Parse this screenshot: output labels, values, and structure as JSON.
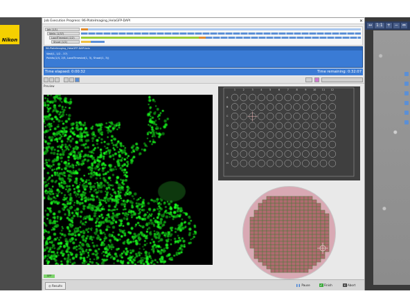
{
  "window": {
    "title": "Job Execution Progress: 96-PlateImaging_HelaGFP-DAPI",
    "close_label": "✕"
  },
  "logo": {
    "text": "Nikon",
    "color": "#f5d000"
  },
  "right_toolbar": {
    "items": [
      "↔",
      "1:1",
      "+",
      "−",
      "⇔"
    ]
  },
  "tasks": [
    {
      "label": "Job (1/1)",
      "color": "#e28a2b"
    },
    {
      "label": "Wells (1/37)",
      "color": "#5b8fd6"
    },
    {
      "label": "LoadTimeslot (1/2)",
      "color": "#9acd32"
    },
    {
      "label": "Shoot (1/2)",
      "color": "#f0c040"
    }
  ],
  "commands": {
    "header": "96-PlateImaging_HelaGFP-DAPI.bdx",
    "lines": [
      "Wall(1, 1/2 - 37)",
      "Points(1/4, 2/5, LoadTimeslot(1, 3), Shoot(1, 3))"
    ]
  },
  "time": {
    "elapsed": "Time elapsed: 0:00:32",
    "remaining": "Time remaining: 0:32:07"
  },
  "preview": {
    "label": "Preview",
    "channel_color": "#22cc22",
    "channel_tag": "GFP"
  },
  "plate": {
    "columns": [
      "1",
      "2",
      "3",
      "4",
      "5",
      "6",
      "7",
      "8",
      "9",
      "10",
      "11",
      "12"
    ],
    "rows": [
      "A",
      "B",
      "C",
      "D",
      "E",
      "F",
      "G",
      "H"
    ],
    "current_well": "C3"
  },
  "wafer": {
    "fill": "#d9a9b4",
    "grid_color": "#4a7a3a"
  },
  "bottom": {
    "results_label": "Results",
    "pause_label": "Pause",
    "finish_label": "Finish",
    "abort_label": "Abort"
  },
  "colors": {
    "accent": "#3a7bd5",
    "desktop": "#4b4b4b"
  }
}
